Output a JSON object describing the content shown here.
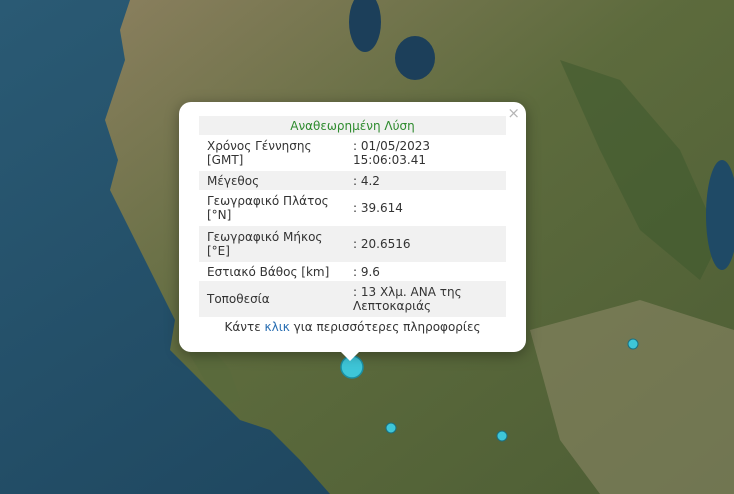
{
  "popup": {
    "title": "Αναθεωρημένη Λύση",
    "close_label": "×",
    "rows": [
      {
        "label": "Χρόνος Γέννησης [GMT]",
        "value": ": 01/05/2023 15:06:03.41"
      },
      {
        "label": "Μέγεθος",
        "value": ": 4.2"
      },
      {
        "label": "Γεωγραφικό Πλάτος [°N]",
        "value": ": 39.614"
      },
      {
        "label": "Γεωγραφικό Μήκος [°E]",
        "value": ": 20.6516"
      },
      {
        "label": "Εστιακό Βάθος [km]",
        "value": ": 9.6"
      },
      {
        "label": "Τοποθεσία",
        "value": ": 13 Χλμ. ΑΝΑ της Λεπτοκαριάς"
      }
    ],
    "footer_before": "Κάντε ",
    "footer_link": "κλικ",
    "footer_after": " για περισσότερες πληροφορίες"
  },
  "colors": {
    "sea": "#1f4a63",
    "land": "#5a6a3c",
    "marker": "#3ec6d8",
    "title_green": "#2e8b2e",
    "link_blue": "#2a6fb3"
  }
}
